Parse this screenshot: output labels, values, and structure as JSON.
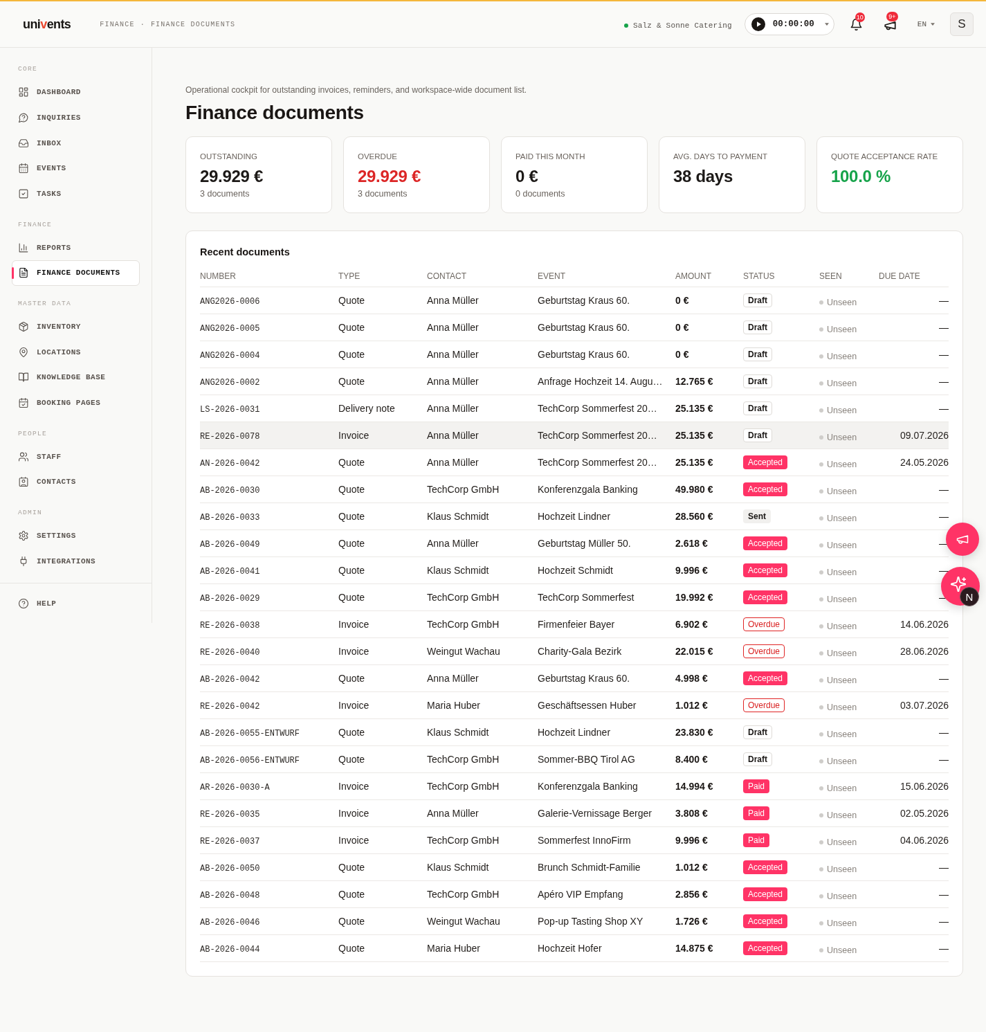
{
  "header": {
    "logo": {
      "start": "uni",
      "accent": "v",
      "end": "ents"
    },
    "breadcrumb": {
      "items": [
        "FINANCE",
        "FINANCE DOCUMENTS"
      ],
      "separator": "·"
    },
    "workspace": {
      "name": "Salz & Sonne Catering",
      "online": true
    },
    "timer": {
      "time": "00:00:00"
    },
    "notifications": {
      "count": "10"
    },
    "announcements": {
      "count": "9+"
    },
    "language": "EN",
    "avatar": "S"
  },
  "sidebar": {
    "sections": [
      {
        "label": "CORE",
        "items": [
          {
            "label": "DASHBOARD",
            "selected": false
          },
          {
            "label": "INQUIRIES",
            "selected": false
          },
          {
            "label": "INBOX",
            "selected": false
          },
          {
            "label": "EVENTS",
            "selected": false
          },
          {
            "label": "TASKS",
            "selected": false
          }
        ]
      },
      {
        "label": "FINANCE",
        "items": [
          {
            "label": "REPORTS",
            "selected": false
          },
          {
            "label": "FINANCE DOCUMENTS",
            "selected": true
          }
        ]
      },
      {
        "label": "MASTER DATA",
        "items": [
          {
            "label": "INVENTORY",
            "selected": false
          },
          {
            "label": "LOCATIONS",
            "selected": false
          },
          {
            "label": "KNOWLEDGE BASE",
            "selected": false
          },
          {
            "label": "BOOKING PAGES",
            "selected": false
          }
        ]
      },
      {
        "label": "PEOPLE",
        "items": [
          {
            "label": "STAFF",
            "selected": false
          },
          {
            "label": "CONTACTS",
            "selected": false
          }
        ]
      },
      {
        "label": "ADMIN",
        "items": [
          {
            "label": "SETTINGS",
            "selected": false
          },
          {
            "label": "INTEGRATIONS",
            "selected": false
          }
        ]
      }
    ],
    "footer": [
      {
        "label": "HELP",
        "selected": false
      }
    ]
  },
  "page": {
    "subtitle": "Operational cockpit for outstanding invoices, reminders, and workspace-wide document list.",
    "title": "Finance documents"
  },
  "kpis": [
    {
      "label": "OUTSTANDING",
      "value": "29.929 €",
      "note": "3 documents",
      "color": "#1c1917"
    },
    {
      "label": "OVERDUE",
      "value": "29.929 €",
      "note": "3 documents",
      "color": "#dc2626"
    },
    {
      "label": "PAID THIS MONTH",
      "value": "0 €",
      "note": "0 documents",
      "color": "#1c1917"
    },
    {
      "label": "AVG. DAYS TO PAYMENT",
      "value": "38 days",
      "color": "#1c1917"
    },
    {
      "label": "QUOTE ACCEPTANCE RATE",
      "value": "100.0 %",
      "color": "#16a34a"
    }
  ],
  "table": {
    "title": "Recent documents",
    "columns": [
      "NUMBER",
      "TYPE",
      "CONTACT",
      "EVENT",
      "AMOUNT",
      "STATUS",
      "SEEN",
      "DUE DATE"
    ],
    "rows": [
      {
        "number": "ANG2026-0006",
        "type": "Quote",
        "contact": "Anna Müller",
        "event": "Geburtstag Kraus 60.",
        "amount": "0 €",
        "status": {
          "label": "Draft",
          "kind": "draft"
        },
        "seen": "Unseen",
        "due_date": "—",
        "selected": false
      },
      {
        "number": "ANG2026-0005",
        "type": "Quote",
        "contact": "Anna Müller",
        "event": "Geburtstag Kraus 60.",
        "amount": "0 €",
        "status": {
          "label": "Draft",
          "kind": "draft"
        },
        "seen": "Unseen",
        "due_date": "—",
        "selected": false
      },
      {
        "number": "ANG2026-0004",
        "type": "Quote",
        "contact": "Anna Müller",
        "event": "Geburtstag Kraus 60.",
        "amount": "0 €",
        "status": {
          "label": "Draft",
          "kind": "draft"
        },
        "seen": "Unseen",
        "due_date": "—",
        "selected": false
      },
      {
        "number": "ANG2026-0002",
        "type": "Quote",
        "contact": "Anna Müller",
        "event": "Anfrage Hochzeit 14. Augu…",
        "amount": "12.765 €",
        "status": {
          "label": "Draft",
          "kind": "draft"
        },
        "seen": "Unseen",
        "due_date": "—",
        "selected": false
      },
      {
        "number": "LS-2026-0031",
        "type": "Delivery note",
        "contact": "Anna Müller",
        "event": "TechCorp Sommerfest 20…",
        "amount": "25.135 €",
        "status": {
          "label": "Draft",
          "kind": "draft"
        },
        "seen": "Unseen",
        "due_date": "—",
        "selected": false
      },
      {
        "number": "RE-2026-0078",
        "type": "Invoice",
        "contact": "Anna Müller",
        "event": "TechCorp Sommerfest 20…",
        "amount": "25.135 €",
        "status": {
          "label": "Draft",
          "kind": "draft"
        },
        "seen": "Unseen",
        "due_date": "09.07.2026",
        "selected": true
      },
      {
        "number": "AN-2026-0042",
        "type": "Quote",
        "contact": "Anna Müller",
        "event": "TechCorp Sommerfest 20…",
        "amount": "25.135 €",
        "status": {
          "label": "Accepted",
          "kind": "accepted"
        },
        "seen": "Unseen",
        "due_date": "24.05.2026",
        "selected": false
      },
      {
        "number": "AB-2026-0030",
        "type": "Quote",
        "contact": "TechCorp GmbH",
        "event": "Konferenzgala Banking",
        "amount": "49.980 €",
        "status": {
          "label": "Accepted",
          "kind": "accepted"
        },
        "seen": "Unseen",
        "due_date": "—",
        "selected": false
      },
      {
        "number": "AB-2026-0033",
        "type": "Quote",
        "contact": "Klaus Schmidt",
        "event": "Hochzeit Lindner",
        "amount": "28.560 €",
        "status": {
          "label": "Sent",
          "kind": "sent"
        },
        "seen": "Unseen",
        "due_date": "—",
        "selected": false
      },
      {
        "number": "AB-2026-0049",
        "type": "Quote",
        "contact": "Anna Müller",
        "event": "Geburtstag Müller 50.",
        "amount": "2.618 €",
        "status": {
          "label": "Accepted",
          "kind": "accepted"
        },
        "seen": "Unseen",
        "due_date": "—",
        "selected": false
      },
      {
        "number": "AB-2026-0041",
        "type": "Quote",
        "contact": "Klaus Schmidt",
        "event": "Hochzeit Schmidt",
        "amount": "9.996 €",
        "status": {
          "label": "Accepted",
          "kind": "accepted"
        },
        "seen": "Unseen",
        "due_date": "—",
        "selected": false
      },
      {
        "number": "AB-2026-0029",
        "type": "Quote",
        "contact": "TechCorp GmbH",
        "event": "TechCorp Sommerfest",
        "amount": "19.992 €",
        "status": {
          "label": "Accepted",
          "kind": "accepted"
        },
        "seen": "Unseen",
        "due_date": "—",
        "selected": false
      },
      {
        "number": "RE-2026-0038",
        "type": "Invoice",
        "contact": "TechCorp GmbH",
        "event": "Firmenfeier Bayer",
        "amount": "6.902 €",
        "status": {
          "label": "Overdue",
          "kind": "overdue"
        },
        "seen": "Unseen",
        "due_date": "14.06.2026",
        "selected": false
      },
      {
        "number": "RE-2026-0040",
        "type": "Invoice",
        "contact": "Weingut Wachau",
        "event": "Charity-Gala Bezirk",
        "amount": "22.015 €",
        "status": {
          "label": "Overdue",
          "kind": "overdue"
        },
        "seen": "Unseen",
        "due_date": "28.06.2026",
        "selected": false
      },
      {
        "number": "AB-2026-0042",
        "type": "Quote",
        "contact": "Anna Müller",
        "event": "Geburtstag Kraus 60.",
        "amount": "4.998 €",
        "status": {
          "label": "Accepted",
          "kind": "accepted"
        },
        "seen": "Unseen",
        "due_date": "—",
        "selected": false
      },
      {
        "number": "RE-2026-0042",
        "type": "Invoice",
        "contact": "Maria Huber",
        "event": "Geschäftsessen Huber",
        "amount": "1.012 €",
        "status": {
          "label": "Overdue",
          "kind": "overdue"
        },
        "seen": "Unseen",
        "due_date": "03.07.2026",
        "selected": false
      },
      {
        "number": "AB-2026-0055-ENTWURF",
        "type": "Quote",
        "contact": "Klaus Schmidt",
        "event": "Hochzeit Lindner",
        "amount": "23.830 €",
        "status": {
          "label": "Draft",
          "kind": "draft"
        },
        "seen": "Unseen",
        "due_date": "—",
        "selected": false
      },
      {
        "number": "AB-2026-0056-ENTWURF",
        "type": "Quote",
        "contact": "TechCorp GmbH",
        "event": "Sommer-BBQ Tirol AG",
        "amount": "8.400 €",
        "status": {
          "label": "Draft",
          "kind": "draft"
        },
        "seen": "Unseen",
        "due_date": "—",
        "selected": false
      },
      {
        "number": "AR-2026-0030-A",
        "type": "Invoice",
        "contact": "TechCorp GmbH",
        "event": "Konferenzgala Banking",
        "amount": "14.994 €",
        "status": {
          "label": "Paid",
          "kind": "paid"
        },
        "seen": "Unseen",
        "due_date": "15.06.2026",
        "selected": false
      },
      {
        "number": "RE-2026-0035",
        "type": "Invoice",
        "contact": "Anna Müller",
        "event": "Galerie-Vernissage Berger",
        "amount": "3.808 €",
        "status": {
          "label": "Paid",
          "kind": "paid"
        },
        "seen": "Unseen",
        "due_date": "02.05.2026",
        "selected": false
      },
      {
        "number": "RE-2026-0037",
        "type": "Invoice",
        "contact": "TechCorp GmbH",
        "event": "Sommerfest InnoFirm",
        "amount": "9.996 €",
        "status": {
          "label": "Paid",
          "kind": "paid"
        },
        "seen": "Unseen",
        "due_date": "04.06.2026",
        "selected": false
      },
      {
        "number": "AB-2026-0050",
        "type": "Quote",
        "contact": "Klaus Schmidt",
        "event": "Brunch Schmidt-Familie",
        "amount": "1.012 €",
        "status": {
          "label": "Accepted",
          "kind": "accepted"
        },
        "seen": "Unseen",
        "due_date": "—",
        "selected": false
      },
      {
        "number": "AB-2026-0048",
        "type": "Quote",
        "contact": "TechCorp GmbH",
        "event": "Apéro VIP Empfang",
        "amount": "2.856 €",
        "status": {
          "label": "Accepted",
          "kind": "accepted"
        },
        "seen": "Unseen",
        "due_date": "—",
        "selected": false
      },
      {
        "number": "AB-2026-0046",
        "type": "Quote",
        "contact": "Weingut Wachau",
        "event": "Pop-up Tasting Shop XY",
        "amount": "1.726 €",
        "status": {
          "label": "Accepted",
          "kind": "accepted"
        },
        "seen": "Unseen",
        "due_date": "—",
        "selected": false
      },
      {
        "number": "AB-2026-0044",
        "type": "Quote",
        "contact": "Maria Huber",
        "event": "Hochzeit Hofer",
        "amount": "14.875 €",
        "status": {
          "label": "Accepted",
          "kind": "accepted"
        },
        "seen": "Unseen",
        "due_date": "—",
        "selected": false
      }
    ]
  },
  "floating": {
    "dev_badge": "N"
  }
}
